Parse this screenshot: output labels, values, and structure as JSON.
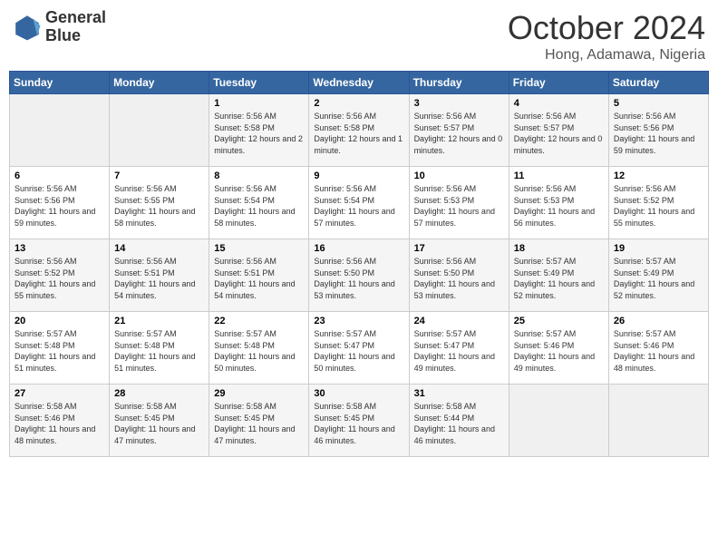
{
  "logo": {
    "line1": "General",
    "line2": "Blue"
  },
  "title": "October 2024",
  "location": "Hong, Adamawa, Nigeria",
  "days_header": [
    "Sunday",
    "Monday",
    "Tuesday",
    "Wednesday",
    "Thursday",
    "Friday",
    "Saturday"
  ],
  "weeks": [
    [
      {
        "day": "",
        "info": ""
      },
      {
        "day": "",
        "info": ""
      },
      {
        "day": "1",
        "info": "Sunrise: 5:56 AM\nSunset: 5:58 PM\nDaylight: 12 hours\nand 2 minutes."
      },
      {
        "day": "2",
        "info": "Sunrise: 5:56 AM\nSunset: 5:58 PM\nDaylight: 12 hours\nand 1 minute."
      },
      {
        "day": "3",
        "info": "Sunrise: 5:56 AM\nSunset: 5:57 PM\nDaylight: 12 hours\nand 0 minutes."
      },
      {
        "day": "4",
        "info": "Sunrise: 5:56 AM\nSunset: 5:57 PM\nDaylight: 12 hours\nand 0 minutes."
      },
      {
        "day": "5",
        "info": "Sunrise: 5:56 AM\nSunset: 5:56 PM\nDaylight: 11 hours\nand 59 minutes."
      }
    ],
    [
      {
        "day": "6",
        "info": "Sunrise: 5:56 AM\nSunset: 5:56 PM\nDaylight: 11 hours\nand 59 minutes."
      },
      {
        "day": "7",
        "info": "Sunrise: 5:56 AM\nSunset: 5:55 PM\nDaylight: 11 hours\nand 58 minutes."
      },
      {
        "day": "8",
        "info": "Sunrise: 5:56 AM\nSunset: 5:54 PM\nDaylight: 11 hours\nand 58 minutes."
      },
      {
        "day": "9",
        "info": "Sunrise: 5:56 AM\nSunset: 5:54 PM\nDaylight: 11 hours\nand 57 minutes."
      },
      {
        "day": "10",
        "info": "Sunrise: 5:56 AM\nSunset: 5:53 PM\nDaylight: 11 hours\nand 57 minutes."
      },
      {
        "day": "11",
        "info": "Sunrise: 5:56 AM\nSunset: 5:53 PM\nDaylight: 11 hours\nand 56 minutes."
      },
      {
        "day": "12",
        "info": "Sunrise: 5:56 AM\nSunset: 5:52 PM\nDaylight: 11 hours\nand 55 minutes."
      }
    ],
    [
      {
        "day": "13",
        "info": "Sunrise: 5:56 AM\nSunset: 5:52 PM\nDaylight: 11 hours\nand 55 minutes."
      },
      {
        "day": "14",
        "info": "Sunrise: 5:56 AM\nSunset: 5:51 PM\nDaylight: 11 hours\nand 54 minutes."
      },
      {
        "day": "15",
        "info": "Sunrise: 5:56 AM\nSunset: 5:51 PM\nDaylight: 11 hours\nand 54 minutes."
      },
      {
        "day": "16",
        "info": "Sunrise: 5:56 AM\nSunset: 5:50 PM\nDaylight: 11 hours\nand 53 minutes."
      },
      {
        "day": "17",
        "info": "Sunrise: 5:56 AM\nSunset: 5:50 PM\nDaylight: 11 hours\nand 53 minutes."
      },
      {
        "day": "18",
        "info": "Sunrise: 5:57 AM\nSunset: 5:49 PM\nDaylight: 11 hours\nand 52 minutes."
      },
      {
        "day": "19",
        "info": "Sunrise: 5:57 AM\nSunset: 5:49 PM\nDaylight: 11 hours\nand 52 minutes."
      }
    ],
    [
      {
        "day": "20",
        "info": "Sunrise: 5:57 AM\nSunset: 5:48 PM\nDaylight: 11 hours\nand 51 minutes."
      },
      {
        "day": "21",
        "info": "Sunrise: 5:57 AM\nSunset: 5:48 PM\nDaylight: 11 hours\nand 51 minutes."
      },
      {
        "day": "22",
        "info": "Sunrise: 5:57 AM\nSunset: 5:48 PM\nDaylight: 11 hours\nand 50 minutes."
      },
      {
        "day": "23",
        "info": "Sunrise: 5:57 AM\nSunset: 5:47 PM\nDaylight: 11 hours\nand 50 minutes."
      },
      {
        "day": "24",
        "info": "Sunrise: 5:57 AM\nSunset: 5:47 PM\nDaylight: 11 hours\nand 49 minutes."
      },
      {
        "day": "25",
        "info": "Sunrise: 5:57 AM\nSunset: 5:46 PM\nDaylight: 11 hours\nand 49 minutes."
      },
      {
        "day": "26",
        "info": "Sunrise: 5:57 AM\nSunset: 5:46 PM\nDaylight: 11 hours\nand 48 minutes."
      }
    ],
    [
      {
        "day": "27",
        "info": "Sunrise: 5:58 AM\nSunset: 5:46 PM\nDaylight: 11 hours\nand 48 minutes."
      },
      {
        "day": "28",
        "info": "Sunrise: 5:58 AM\nSunset: 5:45 PM\nDaylight: 11 hours\nand 47 minutes."
      },
      {
        "day": "29",
        "info": "Sunrise: 5:58 AM\nSunset: 5:45 PM\nDaylight: 11 hours\nand 47 minutes."
      },
      {
        "day": "30",
        "info": "Sunrise: 5:58 AM\nSunset: 5:45 PM\nDaylight: 11 hours\nand 46 minutes."
      },
      {
        "day": "31",
        "info": "Sunrise: 5:58 AM\nSunset: 5:44 PM\nDaylight: 11 hours\nand 46 minutes."
      },
      {
        "day": "",
        "info": ""
      },
      {
        "day": "",
        "info": ""
      }
    ]
  ]
}
